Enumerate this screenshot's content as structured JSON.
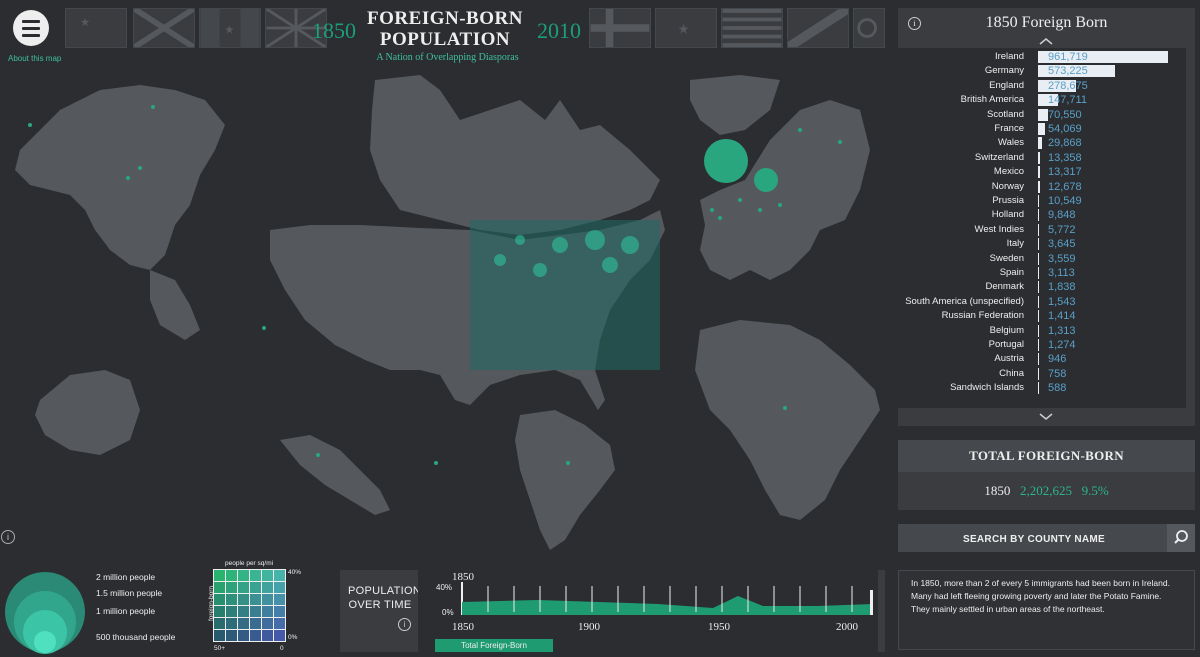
{
  "header": {
    "about_link": "About this map",
    "year_start": "1850",
    "year_end": "2010",
    "title_line1": "FOREIGN-BORN",
    "title_line2": "POPULATION",
    "subtitle": "A Nation of Overlapping Diasporas",
    "menu_icon": "hamburger-icon"
  },
  "panel": {
    "title": "1850 Foreign Born",
    "countries": [
      {
        "name": "Ireland",
        "value": "961,719",
        "num": 961719
      },
      {
        "name": "Germany",
        "value": "573,225",
        "num": 573225
      },
      {
        "name": "England",
        "value": "278,675",
        "num": 278675
      },
      {
        "name": "British America",
        "value": "147,711",
        "num": 147711
      },
      {
        "name": "Scotland",
        "value": "70,550",
        "num": 70550
      },
      {
        "name": "France",
        "value": "54,069",
        "num": 54069
      },
      {
        "name": "Wales",
        "value": "29,868",
        "num": 29868
      },
      {
        "name": "Switzerland",
        "value": "13,358",
        "num": 13358
      },
      {
        "name": "Mexico",
        "value": "13,317",
        "num": 13317
      },
      {
        "name": "Norway",
        "value": "12,678",
        "num": 12678
      },
      {
        "name": "Prussia",
        "value": "10,549",
        "num": 10549
      },
      {
        "name": "Holland",
        "value": "9,848",
        "num": 9848
      },
      {
        "name": "West Indies",
        "value": "5,772",
        "num": 5772
      },
      {
        "name": "Italy",
        "value": "3,645",
        "num": 3645
      },
      {
        "name": "Sweden",
        "value": "3,559",
        "num": 3559
      },
      {
        "name": "Spain",
        "value": "3,113",
        "num": 3113
      },
      {
        "name": "Denmark",
        "value": "1,838",
        "num": 1838
      },
      {
        "name": "South America (unspecified)",
        "value": "1,543",
        "num": 1543
      },
      {
        "name": "Russian Federation",
        "value": "1,414",
        "num": 1414
      },
      {
        "name": "Belgium",
        "value": "1,313",
        "num": 1313
      },
      {
        "name": "Portugal",
        "value": "1,274",
        "num": 1274
      },
      {
        "name": "Austria",
        "value": "946",
        "num": 946
      },
      {
        "name": "China",
        "value": "758",
        "num": 758
      },
      {
        "name": "Sandwich Islands",
        "value": "588",
        "num": 588
      }
    ]
  },
  "total": {
    "title": "TOTAL FOREIGN-BORN",
    "year": "1850",
    "count": "2,202,625",
    "percent": "9.5%"
  },
  "search": {
    "placeholder": "SEARCH BY COUNTY NAME",
    "icon": "search-icon"
  },
  "description": "In 1850, more than 2 of every 5 immigrants had been born in Ireland. Many had left fleeing growing poverty and later the Potato Famine. They mainly settled in urban areas of the northeast.",
  "legend": {
    "size_labels": [
      "2 million people",
      "1.5 million people",
      "1 million people",
      "500 thousand people"
    ],
    "density_title": "people per sq/mi",
    "density_y": "foreign-born",
    "density_top": "40%",
    "density_bottom": "0%",
    "density_left": "50+",
    "density_right": "0"
  },
  "timeline": {
    "title_line1": "POPULATION",
    "title_line2": "OVER TIME",
    "current_year": "1850",
    "y_top": "40%",
    "y_bottom": "0%",
    "ticks": [
      "1850",
      "1900",
      "1950",
      "2000"
    ],
    "button": "Total Foreign-Born"
  },
  "colors": {
    "accent": "#2db58a",
    "bar": "#e8eef3",
    "value": "#5aa0c8",
    "background": "#2b2d30"
  }
}
